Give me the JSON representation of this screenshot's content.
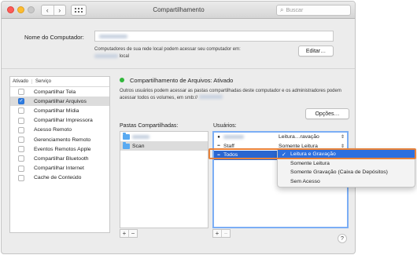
{
  "window": {
    "title": "Compartilhamento",
    "nav_back": "‹",
    "nav_forward": "›"
  },
  "search": {
    "placeholder": "Buscar"
  },
  "computer": {
    "label": "Nome do Computador:",
    "description_1": "Computadores de sua rede local podem acessar seu computador em:",
    "description_2": "local",
    "edit_button": "Editar…"
  },
  "services": {
    "col_enabled": "Ativado",
    "col_service": "Serviço",
    "items": [
      {
        "label": "Compartilhar Tela",
        "enabled": false
      },
      {
        "label": "Compartilhar Arquivos",
        "enabled": true
      },
      {
        "label": "Compartilhar Mídia",
        "enabled": false
      },
      {
        "label": "Compartilhar Impressora",
        "enabled": false
      },
      {
        "label": "Acesso Remoto",
        "enabled": false
      },
      {
        "label": "Gerenciamento Remoto",
        "enabled": false
      },
      {
        "label": "Eventos Remotos Apple",
        "enabled": false
      },
      {
        "label": "Compartilhar Bluetooth",
        "enabled": false
      },
      {
        "label": "Compartilhar Internet",
        "enabled": false
      },
      {
        "label": "Cache de Conteúdo",
        "enabled": false
      }
    ],
    "selected_index": 1
  },
  "file_sharing": {
    "status": "Compartilhamento de Arquivos: Ativado",
    "status_color": "#31b73b",
    "description": "Outros usuários podem acessar as pastas compartilhadas deste computador e os administradores podem acessar todos os volumes, em smb://",
    "options_button": "Opções…",
    "folders_label": "Pastas Compartilhadas:",
    "users_label": "Usuários:",
    "folders": [
      {
        "name": "",
        "redacted": true
      },
      {
        "name": "Scan",
        "redacted": false
      }
    ],
    "users": [
      {
        "icon": "user-icon",
        "name": "",
        "redacted": true,
        "permission": "Leitura…ravação"
      },
      {
        "icon": "group-icon",
        "name": "Staff",
        "redacted": false,
        "permission": "Somente Leitura"
      },
      {
        "icon": "everyone-icon",
        "name": "Todos",
        "redacted": false,
        "permission": "Leitura e Gravação"
      }
    ],
    "add_symbol": "+",
    "remove_symbol": "−"
  },
  "permission_menu": {
    "items": [
      "Leitura e Gravação",
      "Somente Leitura",
      "Somente Gravação (Caixa de Depósitos)",
      "Sem Acesso"
    ],
    "selected_index": 0,
    "check_symbol": "✓"
  },
  "help": {
    "symbol": "?"
  },
  "colors": {
    "selection_blue": "#2c6fdf",
    "highlight_orange": "#e8823a",
    "folder_blue": "#5aaaf1"
  }
}
